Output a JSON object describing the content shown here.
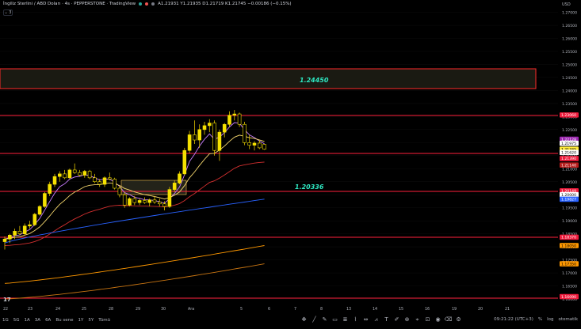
{
  "header": {
    "symbol": "İngiliz Sterlini / ABD Doları · 4s · PEPPERSTONE · TradingView",
    "ohlc": "A1.21931  Y1.21935  D1.21719  K1.21745  −0.00186 (−0.15%)",
    "collapse_label": "⌄ 3",
    "dot_colors": [
      "#26a69a",
      "#ef5350",
      "#787b86"
    ]
  },
  "price_axis": {
    "currency": "USD",
    "ticks": [
      "1.27000",
      "1.26500",
      "1.26000",
      "1.25500",
      "1.25000",
      "1.24500",
      "1.24000",
      "1.23500",
      "1.23000",
      "1.22500",
      "1.22000",
      "1.21500",
      "1.21000",
      "1.20500",
      "1.20000",
      "1.19500",
      "1.19000",
      "1.18500",
      "1.18000",
      "1.17500",
      "1.17000",
      "1.16500",
      "1.16000"
    ],
    "badges": [
      {
        "label": "1.23060",
        "price": 1.2306,
        "color": "#ef1b3c",
        "text": "#fff"
      },
      {
        "label": "1.22128",
        "price": 1.22128,
        "color": "#9c27b0",
        "text": "#fff"
      },
      {
        "label": "1.21975",
        "price": 1.21975,
        "color": "#ffffff",
        "text": "#000"
      },
      {
        "label": "1.21745",
        "price": 1.21745,
        "color": "#ffeb3b",
        "text": "#000"
      },
      {
        "label": "1.21620",
        "price": 1.2162,
        "color": "#ffffff",
        "text": "#000"
      },
      {
        "label": "1.21390",
        "price": 1.2139,
        "color": "#ef1b3c",
        "text": "#fff"
      },
      {
        "label": "1.21140",
        "price": 1.2114,
        "color": "#b71c1c",
        "text": "#fff"
      },
      {
        "label": "1.20149",
        "price": 1.20149,
        "color": "#ef1b3c",
        "text": "#fff"
      },
      {
        "label": "1.20000",
        "price": 1.2,
        "color": "#ffffff",
        "text": "#000"
      },
      {
        "label": "1.19827",
        "price": 1.19827,
        "color": "#2962ff",
        "text": "#fff"
      },
      {
        "label": "1.18370",
        "price": 1.1837,
        "color": "#ef1b3c",
        "text": "#fff"
      },
      {
        "label": "1.18050",
        "price": 1.1805,
        "color": "#ff9800",
        "text": "#000"
      },
      {
        "label": "1.17350",
        "price": 1.1735,
        "color": "#ff9800",
        "text": "#000"
      },
      {
        "label": "1.16090",
        "price": 1.1609,
        "color": "#ef1b3c",
        "text": "#fff"
      }
    ]
  },
  "time_axis": {
    "ticks": [
      "22",
      "23",
      "24",
      "25",
      "28",
      "29",
      "30",
      "Ara",
      "5",
      "6",
      "7",
      "8",
      "13",
      "14",
      "15",
      "16",
      "19",
      "20",
      "21"
    ]
  },
  "annotations": {
    "zone_label": "1.24450",
    "level_label": "1.20336",
    "text_color": "#2ee6c0"
  },
  "toolbar": {
    "ranges": [
      "1G",
      "5G",
      "1A",
      "3A",
      "6A",
      "Bu sene",
      "1Y",
      "5Y",
      "Tümü"
    ],
    "clock": "09:21:22 (UTC+3)",
    "pct": "%",
    "log": "log",
    "auto": "otomatik"
  },
  "chart_data": {
    "type": "candlestick",
    "symbol": "GBPUSD",
    "timeframe": "4s",
    "ylim": [
      1.1585,
      1.2735
    ],
    "candles": [
      [
        1.182,
        1.184,
        1.179,
        1.183
      ],
      [
        1.183,
        1.185,
        1.1815,
        1.1845
      ],
      [
        1.1845,
        1.187,
        1.183,
        1.186
      ],
      [
        1.186,
        1.188,
        1.1845,
        1.185
      ],
      [
        1.185,
        1.189,
        1.1845,
        1.188
      ],
      [
        1.188,
        1.19,
        1.187,
        1.1885
      ],
      [
        1.1885,
        1.193,
        1.188,
        1.1925
      ],
      [
        1.1925,
        1.196,
        1.192,
        1.1955
      ],
      [
        1.1955,
        1.201,
        1.195,
        1.2005
      ],
      [
        1.2005,
        1.205,
        1.1995,
        1.204
      ],
      [
        1.204,
        1.208,
        1.203,
        1.207
      ],
      [
        1.207,
        1.209,
        1.205,
        1.208
      ],
      [
        1.208,
        1.2095,
        1.206,
        1.2065
      ],
      [
        1.2065,
        1.21,
        1.206,
        1.2095
      ],
      [
        1.2095,
        1.212,
        1.208,
        1.2085
      ],
      [
        1.2085,
        1.2095,
        1.207,
        1.2075
      ],
      [
        1.2075,
        1.2095,
        1.2065,
        1.209
      ],
      [
        1.209,
        1.2095,
        1.206,
        1.2065
      ],
      [
        1.2065,
        1.208,
        1.2045,
        1.205
      ],
      [
        1.205,
        1.206,
        1.203,
        1.204
      ],
      [
        1.204,
        1.207,
        1.203,
        1.2065
      ],
      [
        1.2065,
        1.2085,
        1.2055,
        1.206
      ],
      [
        1.206,
        1.2065,
        1.202,
        1.2025
      ],
      [
        1.2025,
        1.2035,
        1.199,
        1.2
      ],
      [
        1.2,
        1.201,
        1.195,
        1.196
      ],
      [
        1.196,
        1.199,
        1.1955,
        1.1985
      ],
      [
        1.1985,
        1.1995,
        1.196,
        1.197
      ],
      [
        1.197,
        1.1985,
        1.196,
        1.1978
      ],
      [
        1.1978,
        1.199,
        1.1965,
        1.197
      ],
      [
        1.197,
        1.1985,
        1.1955,
        1.198
      ],
      [
        1.198,
        1.1995,
        1.1965,
        1.1972
      ],
      [
        1.1972,
        1.1985,
        1.1955,
        1.1965
      ],
      [
        1.1965,
        1.1975,
        1.194,
        1.1955
      ],
      [
        1.1955,
        1.203,
        1.195,
        1.202
      ],
      [
        1.202,
        1.2055,
        1.201,
        1.2045
      ],
      [
        1.2045,
        1.209,
        1.204,
        1.208
      ],
      [
        1.208,
        1.218,
        1.2075,
        1.217
      ],
      [
        1.217,
        1.2245,
        1.216,
        1.223
      ],
      [
        1.223,
        1.2285,
        1.2195,
        1.221
      ],
      [
        1.221,
        1.227,
        1.218,
        1.225
      ],
      [
        1.225,
        1.228,
        1.223,
        1.2265
      ],
      [
        1.2265,
        1.229,
        1.224,
        1.2275
      ],
      [
        1.2275,
        1.2285,
        1.215,
        1.217
      ],
      [
        1.217,
        1.225,
        1.213,
        1.224
      ],
      [
        1.224,
        1.2275,
        1.222,
        1.227
      ],
      [
        1.227,
        1.232,
        1.226,
        1.2305
      ],
      [
        1.2305,
        1.2325,
        1.2285,
        1.231
      ],
      [
        1.231,
        1.2315,
        1.226,
        1.227
      ],
      [
        1.227,
        1.228,
        1.219,
        1.22
      ],
      [
        1.22,
        1.223,
        1.2175,
        1.219
      ],
      [
        1.219,
        1.2205,
        1.217,
        1.2198
      ],
      [
        1.2198,
        1.221,
        1.2175,
        1.218
      ],
      [
        1.2193,
        1.2194,
        1.2172,
        1.21745
      ]
    ]
  }
}
